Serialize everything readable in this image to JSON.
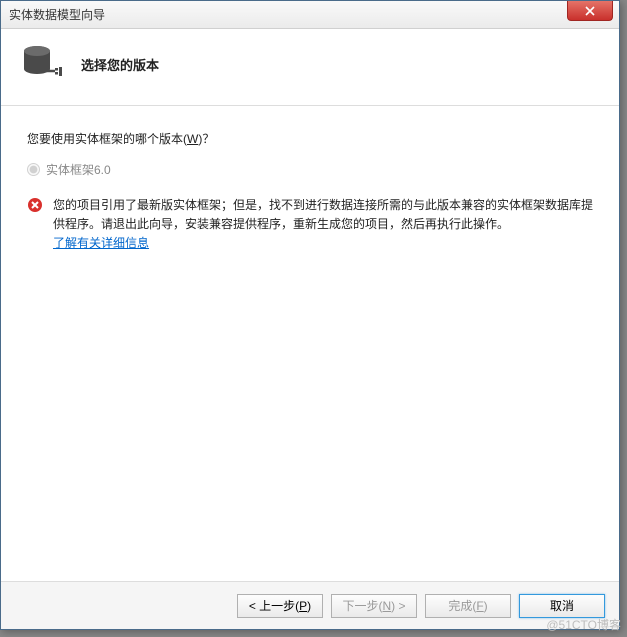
{
  "window": {
    "title": "实体数据模型向导"
  },
  "header": {
    "title": "选择您的版本"
  },
  "prompt": {
    "label_pre": "您要使用实体框架的哪个版本(",
    "label_mnemonic": "W",
    "label_post": ")？"
  },
  "options": {
    "ef6": "实体框架6.0"
  },
  "error": {
    "message": "您的项目引用了最新版实体框架；但是，找不到进行数据连接所需的与此版本兼容的实体框架数据库提供程序。请退出此向导，安装兼容提供程序，重新生成您的项目，然后再执行此操作。",
    "link": "了解有关详细信息"
  },
  "buttons": {
    "back_pre": "< 上一步(",
    "back_m": "P",
    "back_post": ")",
    "next_pre": "下一步(",
    "next_m": "N",
    "next_post": ") >",
    "finish_pre": "完成(",
    "finish_m": "F",
    "finish_post": ")",
    "cancel": "取消"
  },
  "watermark": "@51CTO博客"
}
